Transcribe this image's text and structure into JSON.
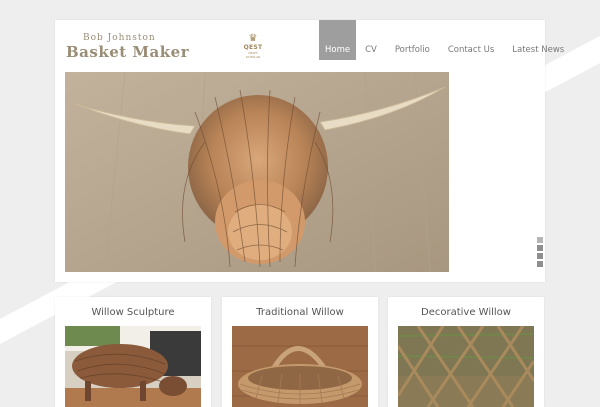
{
  "header": {
    "brand_top": "Bob Johnston",
    "brand_main": "Basket Maker",
    "qest_badge": "QEST",
    "qest_subtitle": "CRAFT SCHOLAR"
  },
  "nav": {
    "items": [
      {
        "label": "Home",
        "active": true
      },
      {
        "label": "CV",
        "active": false
      },
      {
        "label": "Portfolio",
        "active": false
      },
      {
        "label": "Contact Us",
        "active": false
      },
      {
        "label": "Latest News",
        "active": false
      }
    ]
  },
  "slider": {
    "slides": 4,
    "active_slide": 1
  },
  "cards": [
    {
      "title": "Willow Sculpture"
    },
    {
      "title": "Traditional Willow"
    },
    {
      "title": "Decorative Willow"
    }
  ],
  "colors": {
    "page_background": "#eeeeee",
    "brand_text": "#9a8d76",
    "nav_active_background": "#9e9e9e",
    "nav_text": "#7a7a7a",
    "card_title_text": "#555555"
  }
}
